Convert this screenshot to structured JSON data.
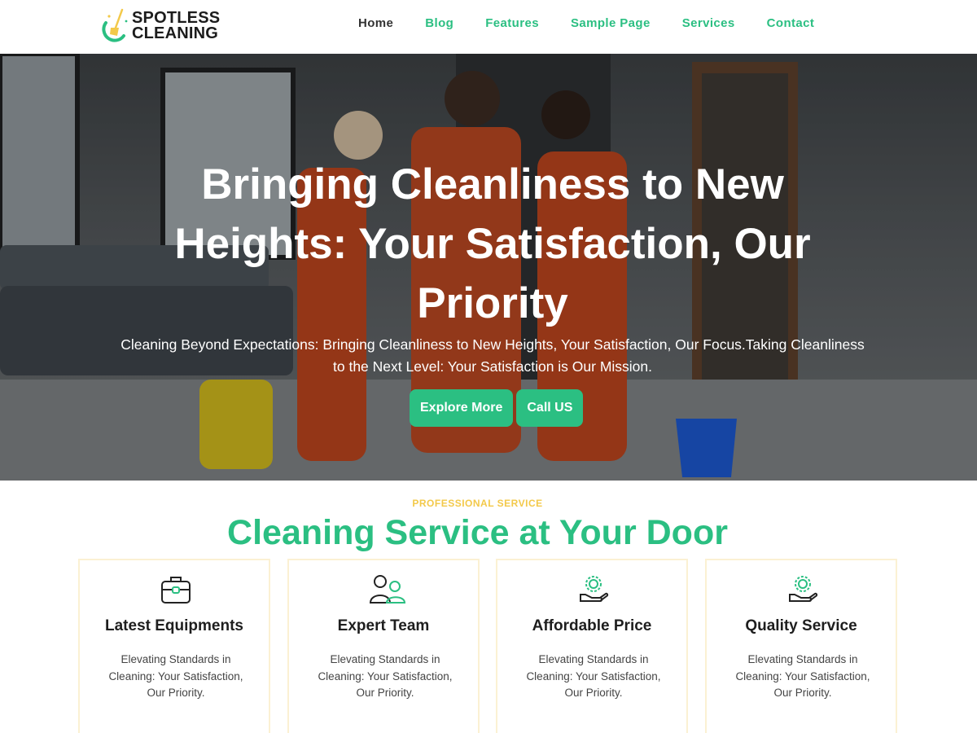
{
  "brand": {
    "line1": "SPOTLESS",
    "line2": "CLEANING",
    "accent_color": "#2bbf82",
    "secondary_color": "#f3c94a"
  },
  "nav": {
    "items": [
      {
        "label": "Home",
        "active": true
      },
      {
        "label": "Blog",
        "active": false
      },
      {
        "label": "Features",
        "active": false
      },
      {
        "label": "Sample Page",
        "active": false
      },
      {
        "label": "Services",
        "active": false
      },
      {
        "label": "Contact",
        "active": false
      }
    ]
  },
  "hero": {
    "title_line1": "Bringing Cleanliness to New",
    "title_line2": "Heights: Your Satisfaction, Our",
    "title_line3": "Priority",
    "subtitle_line1": "Cleaning Beyond Expectations: Bringing Cleanliness to New Heights, Your Satisfaction, Our Focus.Taking Cleanliness",
    "subtitle_line2": "to the Next Level: Your Satisfaction is Our Mission.",
    "primary_button": "Explore More",
    "secondary_button": "Call US"
  },
  "services": {
    "eyebrow": "PROFESSIONAL SERVICE",
    "title": "Cleaning Service at Your Door",
    "cards": [
      {
        "icon": "toolbox-icon",
        "title": "Latest Equipments",
        "text": "Elevating Standards in Cleaning: Your Satisfaction, Our Priority."
      },
      {
        "icon": "team-icon",
        "title": "Expert Team",
        "text": "Elevating Standards in Cleaning: Your Satisfaction, Our Priority."
      },
      {
        "icon": "gear-hand-icon",
        "title": "Affordable Price",
        "text": "Elevating Standards in Cleaning: Your Satisfaction, Our Priority."
      },
      {
        "icon": "gear-hand-icon",
        "title": "Quality Service",
        "text": "Elevating Standards in Cleaning: Your Satisfaction, Our Priority."
      }
    ]
  }
}
